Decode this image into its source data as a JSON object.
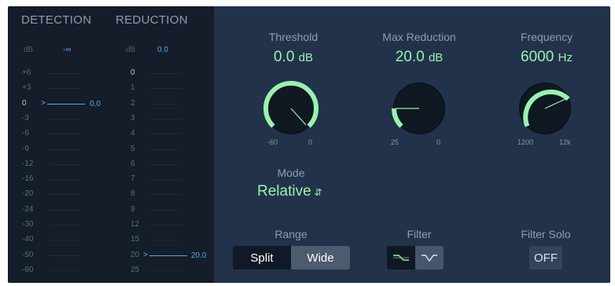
{
  "detection": {
    "title": "DETECTION",
    "unit": "dB",
    "peak": "-∞",
    "scale": [
      "+6",
      "+3",
      "0",
      "-3",
      "-6",
      "-9",
      "-12",
      "-16",
      "-20",
      "-24",
      "-30",
      "-40",
      "-50",
      "-60"
    ],
    "marker_value": "0.0"
  },
  "reduction": {
    "title": "REDUCTION",
    "unit": "dB",
    "peak": "0.0",
    "scale": [
      "0",
      "1",
      "2",
      "3",
      "4",
      "5",
      "6",
      "7",
      "8",
      "9",
      "12",
      "15",
      "20",
      "25"
    ],
    "marker_value": "20.0"
  },
  "threshold": {
    "label": "Threshold",
    "value": "0.0",
    "unit": "dB",
    "min_label": "-60",
    "max_label": "0"
  },
  "max_reduction": {
    "label": "Max Reduction",
    "value": "20.0",
    "unit": "dB",
    "min_label": "25",
    "max_label": "0"
  },
  "frequency": {
    "label": "Frequency",
    "value": "6000",
    "unit": "Hz",
    "min_label": "1200",
    "max_label": "12k"
  },
  "mode": {
    "label": "Mode",
    "value": "Relative",
    "chevron": "⌃⌄"
  },
  "range": {
    "label": "Range",
    "options": [
      "Split",
      "Wide"
    ],
    "selected": "Split"
  },
  "filter": {
    "label": "Filter",
    "options": [
      "high-pass-filter-icon",
      "peak-filter-icon"
    ],
    "selected": "high-pass-filter-icon"
  },
  "filter_solo": {
    "label": "Filter Solo",
    "value": "OFF"
  },
  "colors": {
    "accent": "#9af2ae",
    "meter_blue": "#56a7ea",
    "panel": "#21324a",
    "meter_bg": "#141d29"
  }
}
